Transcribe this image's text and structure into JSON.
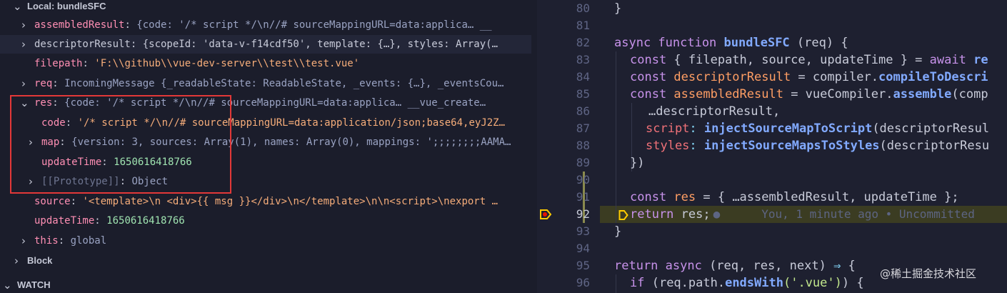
{
  "debug": {
    "local_section": "Local: bundleSFC",
    "block_section": "Block",
    "watch_section": "WATCH",
    "rows": {
      "assembledResult_key": "assembledResult",
      "assembledResult_val": "{code: '/* script */\\n//# sourceMappingURL=data:applica…   __",
      "descriptorResult_key": "descriptorResult",
      "descriptorResult_val": "{scopeId: 'data-v-f14cdf50', template: {…}, styles: Array(…",
      "filepath_key": "filepath",
      "filepath_val": "'F:\\\\github\\\\vue-dev-server\\\\test\\\\test.vue'",
      "req_key": "req",
      "req_val": "IncomingMessage {_readableState: ReadableState, _events: {…}, _eventsCou…",
      "res_key": "res",
      "res_val": "{code: '/* script */\\n//# sourceMappingURL=data:applica…   __vue_create…",
      "code_key": "code",
      "code_val": "'/* script */\\n//# sourceMappingURL=data:application/json;base64,eyJ2Z…",
      "map_key": "map",
      "map_val": "{version: 3, sources: Array(1), names: Array(0), mappings: ';;;;;;;;AAMA…",
      "res_updateTime_key": "updateTime",
      "res_updateTime_val": "1650616418766",
      "prototype_key": "[[Prototype]]",
      "prototype_val": "Object",
      "source_key": "source",
      "source_val": "'<template>\\n  <div>{{ msg }}</div>\\n</template>\\n\\n<script>\\nexport …",
      "updateTime_key": "updateTime",
      "updateTime_val": "1650616418766",
      "this_key": "this",
      "this_val": "global"
    }
  },
  "editor": {
    "line_numbers": [
      "80",
      "81",
      "82",
      "83",
      "84",
      "85",
      "86",
      "87",
      "88",
      "89",
      "90",
      "91",
      "92",
      "93",
      "94",
      "95",
      "96"
    ],
    "blame": "You, 1 minute ago • Uncommitted",
    "l80": "}",
    "l82_kw": "async function",
    "l82_fn": "bundleSFC",
    "l82_rest": " (req) {",
    "l83_kw": "const",
    "l83_rest": " { filepath, source, updateTime } = ",
    "l83_kw2": "await",
    "l83_tail": " re",
    "l84_kw": "const",
    "l84_id": " descriptorResult",
    "l84_mid": " = compiler.",
    "l84_fn": "compileToDescri",
    "l85_kw": "const",
    "l85_id": " assembledResult",
    "l85_mid": " = vueCompiler.",
    "l85_fn": "assemble",
    "l85_tail": "(comp",
    "l86": "…descriptorResult,",
    "l87_prop": "script",
    "l87_fn": "injectSourceMapToScript",
    "l87_tail": "(descriptorResul",
    "l88_prop": "styles",
    "l88_fn": "injectSourceMapsToStyles",
    "l88_tail": "(descriptorResu",
    "l89": "})",
    "l91_kw": "const",
    "l91_id": " res",
    "l91_rest": " = { …assembledResult, updateTime };",
    "l92_kw": "return",
    "l92_rest": " res;",
    "l93": "}",
    "l95_kw": "return async",
    "l95_rest": " (req, res, next) ",
    "l95_op": "⇒",
    "l95_tail": " {",
    "l96_kw": "if",
    "l96_rest": " (req.path.",
    "l96_fn": "endsWith",
    "l96_str": "('.vue')",
    "l96_tail": ") {"
  },
  "watermark": "@稀土掘金技术社区"
}
